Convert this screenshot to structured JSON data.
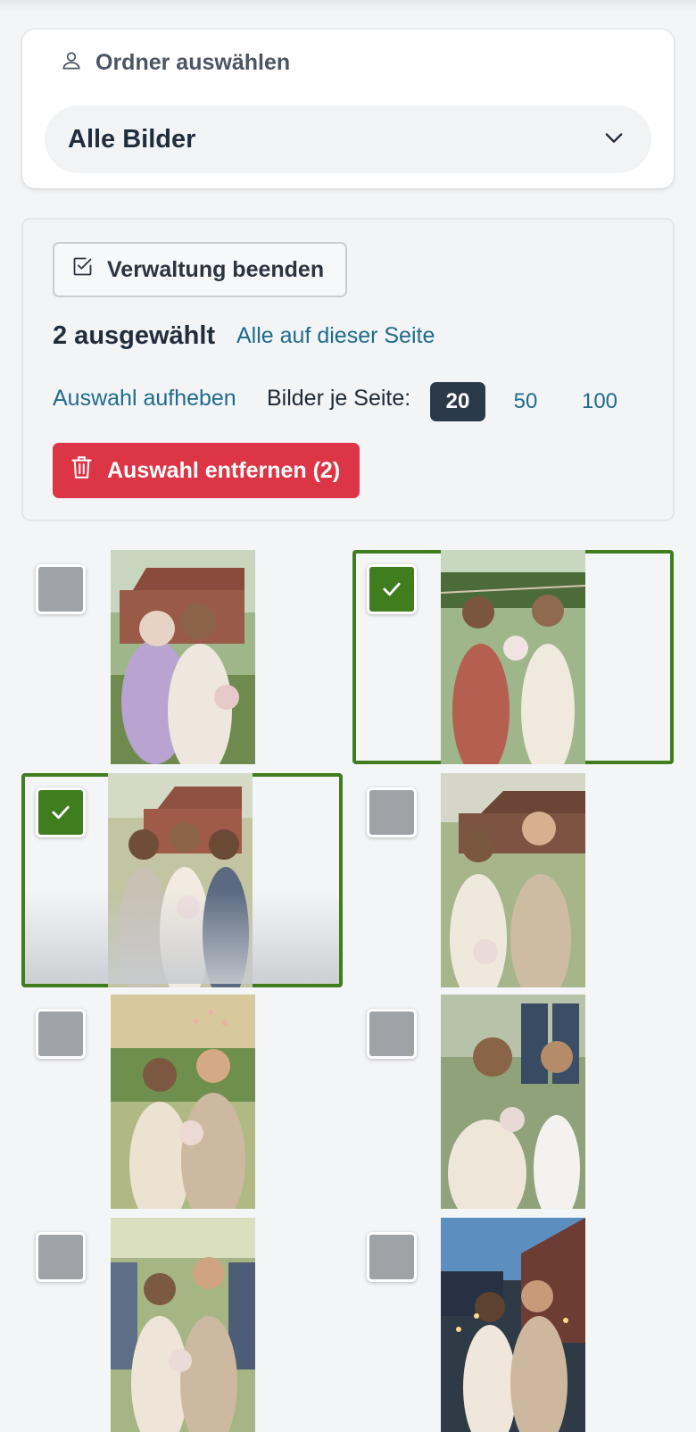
{
  "folder": {
    "label": "Ordner auswählen",
    "selected": "Alle Bilder",
    "icons": {
      "label": "user-icon",
      "select": "chevron-down-icon"
    }
  },
  "manage": {
    "end_button_label": "Verwaltung beenden",
    "selected_count_text": "2 ausgewählt",
    "select_all_label": "Alle auf dieser Seite",
    "clear_selection_label": "Auswahl aufheben",
    "per_page_label": "Bilder je Seite:",
    "per_page_options": [
      "20",
      "50",
      "100"
    ],
    "per_page_selected": "20",
    "remove_button_label": "Auswahl entfernen (2)",
    "colors": {
      "danger": "#dc3545",
      "link": "#1e6b8c",
      "active_page": "#2b3a4a",
      "selected": "#3f7d1e"
    }
  },
  "gallery": {
    "items": [
      {
        "selected": false,
        "subject": "older woman hugging bride"
      },
      {
        "selected": true,
        "subject": "bride with bridesmaid"
      },
      {
        "selected": true,
        "subject": "bride with two bridesmaids"
      },
      {
        "selected": false,
        "subject": "couple toasting"
      },
      {
        "selected": false,
        "subject": "couple with confetti"
      },
      {
        "selected": false,
        "subject": "bride with flower girl"
      },
      {
        "selected": false,
        "subject": "couple in crowd"
      },
      {
        "selected": false,
        "subject": "couple at dusk with sparklers"
      }
    ]
  }
}
